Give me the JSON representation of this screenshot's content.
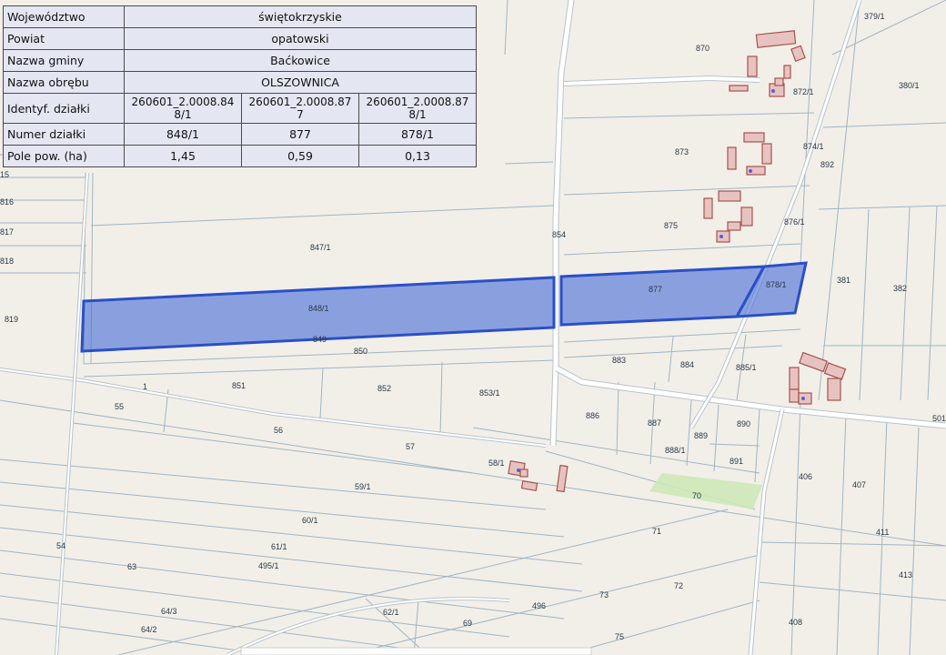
{
  "info_table": {
    "voivodeship": {
      "label": "Województwo",
      "value": "świętokrzyskie"
    },
    "county": {
      "label": "Powiat",
      "value": "opatowski"
    },
    "commune": {
      "label": "Nazwa gminy",
      "value": "Baćkowice"
    },
    "precinct": {
      "label": "Nazwa obrębu",
      "value": "OLSZOWNICA"
    },
    "ids": {
      "label": "Identyf. działki",
      "values": [
        "260601_2.0008.848/1",
        "260601_2.0008.877",
        "260601_2.0008.878/1"
      ]
    },
    "numbers": {
      "label": "Numer działki",
      "values": [
        "848/1",
        "877",
        "878/1"
      ]
    },
    "areas": {
      "label": "Pole pow. (ha)",
      "values": [
        "1,45",
        "0,59",
        "0,13"
      ]
    }
  },
  "map": {
    "colors": {
      "background": "#f2efe8",
      "parcel_line": "#9fb6c5",
      "road": "#ffffff",
      "road_edge": "#b8c4cc",
      "highlight_fill": "#4a6fd8",
      "highlight_edge": "#2a4fc8",
      "building_fill": "#e6c3c0",
      "building_edge": "#a7524e",
      "green": "#cde8b8"
    },
    "parcel_labels": {
      "p379_1": "379/1",
      "p870": "870",
      "p380_1": "380/1",
      "p872_1": "872/1",
      "p873": "873",
      "p874_1": "874/1",
      "p892": "892",
      "p815": "15",
      "p816": "816",
      "p817": "817",
      "p818": "818",
      "p819": "819",
      "p847_1": "847/1",
      "p854": "854",
      "p875": "875",
      "p876_1": "876/1",
      "p381": "381",
      "p382": "382",
      "p848_1": "848/1",
      "p877": "877",
      "p878_1": "878/1",
      "p849": "849",
      "p850": "850",
      "p883": "883",
      "p884": "884",
      "p885_1": "885/1",
      "p851": "851",
      "p852": "852",
      "p853_1": "853/1",
      "p1": "1",
      "p55": "55",
      "p56": "56",
      "p886": "886",
      "p887": "887",
      "p889": "889",
      "p890": "890",
      "p57": "57",
      "p888_1": "888/1",
      "p891": "891",
      "p58_1": "58/1",
      "p59_1": "59/1",
      "p406": "406",
      "p407": "407",
      "p501": "501",
      "p70": "70",
      "p60_1": "60/1",
      "p71": "71",
      "p411": "411",
      "p54": "54",
      "p61_1": "61/1",
      "p495_1": "495/1",
      "p63": "63",
      "p413": "413",
      "p72": "72",
      "p73": "73",
      "p496": "496",
      "p64_3": "64/3",
      "p62_1": "62/1",
      "p69": "69",
      "p408": "408",
      "p64_2": "64/2",
      "p75": "75"
    }
  }
}
